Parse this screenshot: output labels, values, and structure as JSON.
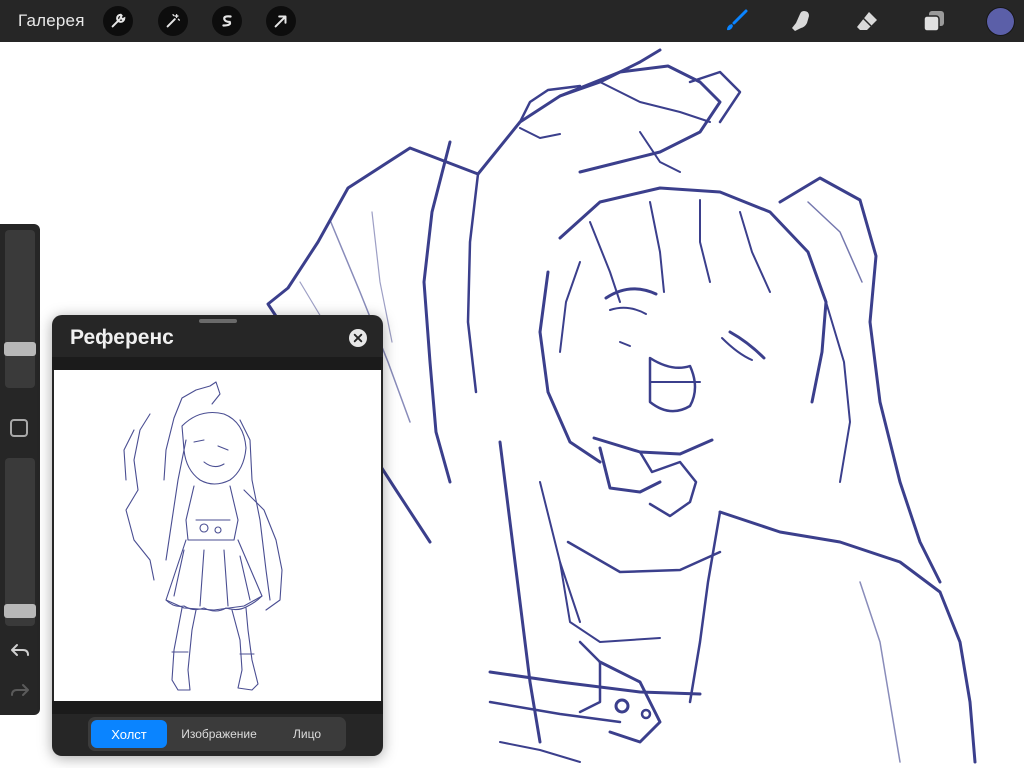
{
  "topbar": {
    "gallery_label": "Галерея",
    "left_tools": [
      {
        "name": "adjustments",
        "icon": "wrench-icon"
      },
      {
        "name": "adjust-effects",
        "icon": "magic-wand-icon"
      },
      {
        "name": "selection",
        "icon": "selection-s-icon"
      },
      {
        "name": "transform",
        "icon": "arrow-cursor-icon"
      }
    ],
    "right_tools": [
      {
        "name": "brush",
        "icon": "brush-icon",
        "active": true
      },
      {
        "name": "smudge",
        "icon": "smudge-finger-icon",
        "active": false
      },
      {
        "name": "eraser",
        "icon": "eraser-icon",
        "active": false
      },
      {
        "name": "layers",
        "icon": "layers-icon",
        "active": false
      }
    ],
    "current_color": "#5B5FA8"
  },
  "colors": {
    "toolbar_bg": "#262626",
    "accent_blue": "#0A84FF",
    "sketch_stroke": "#3B3F8C"
  },
  "sidebar": {
    "brush_size_level": 0.22,
    "opacity_level": 0.05,
    "modify_icon": "square-modify-icon",
    "undo_icon": "undo-arrow-icon",
    "redo_icon": "redo-arrow-icon"
  },
  "reference": {
    "title": "Референс",
    "close_icon": "close-icon",
    "tabs": [
      {
        "label": "Холст",
        "active": true
      },
      {
        "label": "Изображение",
        "active": false
      },
      {
        "label": "Лицо",
        "active": false
      }
    ]
  }
}
